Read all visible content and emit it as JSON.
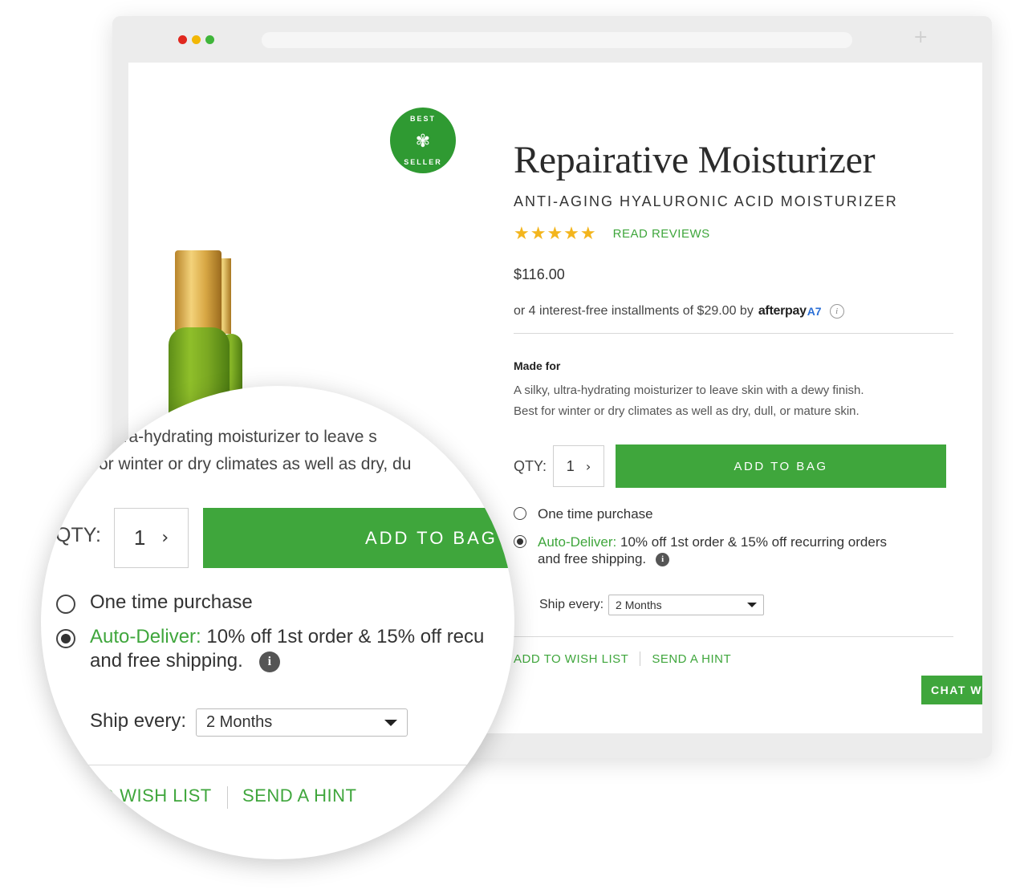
{
  "colors": {
    "brand_green": "#3fa63c",
    "star_yellow": "#f3b51d",
    "dot_red": "#e0281f",
    "dot_yellow": "#f2b705",
    "dot_green": "#3fb53a",
    "afterpay_blue": "#2b6fd6"
  },
  "browser": {
    "new_tab_icon": "+"
  },
  "badge": {
    "top_text": "BEST",
    "bottom_text": "SELLER",
    "icon": "palm-trees-icon"
  },
  "product": {
    "title": "Repairative Moisturizer",
    "subtitle": "ANTI-AGING HYALURONIC ACID MOISTURIZER",
    "rating_stars": "★★★★★",
    "rating_value": 5,
    "read_reviews": "READ REVIEWS",
    "price": "$116.00",
    "afterpay_text": "or 4 interest-free installments of $29.00 by",
    "afterpay_brand": "afterpay",
    "afterpay_mark": "A7",
    "info_icon": "i",
    "made_for_label": "Made for",
    "description_line1": "A silky, ultra-hydrating moisturizer to leave skin with a dewy finish.",
    "description_line2": "Best for winter or dry climates as well as dry, dull, or mature skin."
  },
  "purchase": {
    "qty_label": "QTY:",
    "qty_value": "1",
    "qty_chevron": "›",
    "add_to_bag": "ADD TO BAG",
    "one_time_label": "One time purchase",
    "auto_deliver_label": "Auto-Deliver:",
    "auto_deliver_text": "10% off 1st order & 15% off recurring orders",
    "auto_deliver_text2": "and free shipping.",
    "ship_every_label": "Ship every:",
    "ship_every_value": "2 Months",
    "add_to_wish_list": "ADD TO WISH LIST",
    "send_a_hint": "SEND A HINT",
    "chat": "CHAT W"
  },
  "magnifier": {
    "desc_line1": "ltra-hydrating moisturizer to leave s",
    "desc_line2": "or winter or dry climates as well as dry, du",
    "qty_label": "QTY:",
    "qty_value": "1",
    "add_to_bag": "ADD TO BAG",
    "one_time_label": "One time purchase",
    "auto_deliver_label": "Auto-Deliver:",
    "auto_deliver_text": "10% off 1st order & 15% off recu",
    "auto_deliver_text2": "and free shipping.",
    "ship_every_label": "Ship every:",
    "ship_every_value": "2 Months",
    "wish_list_partial": "O WISH LIST",
    "send_a_hint": "SEND A HINT"
  }
}
